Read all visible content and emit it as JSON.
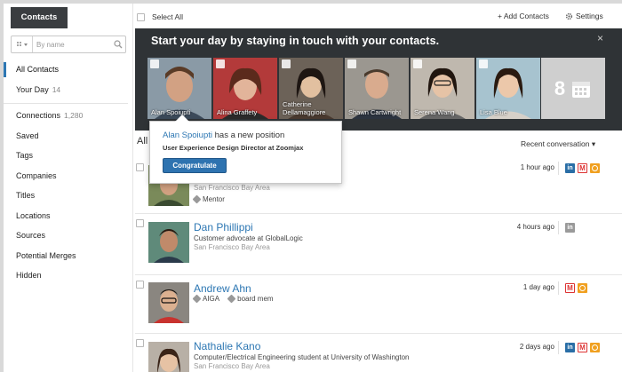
{
  "sidebar": {
    "tab_label": "Contacts",
    "search_placeholder": "By name",
    "items": [
      {
        "label": "All Contacts",
        "count": ""
      },
      {
        "label": "Your Day",
        "count": "14"
      },
      {
        "label": "Connections",
        "count": "1,280"
      },
      {
        "label": "Saved",
        "count": ""
      },
      {
        "label": "Tags",
        "count": ""
      },
      {
        "label": "Companies",
        "count": ""
      },
      {
        "label": "Titles",
        "count": ""
      },
      {
        "label": "Locations",
        "count": ""
      },
      {
        "label": "Sources",
        "count": ""
      },
      {
        "label": "Potential Merges",
        "count": ""
      },
      {
        "label": "Hidden",
        "count": ""
      }
    ]
  },
  "toolbar": {
    "select_all": "Select All",
    "add_contacts": "+ Add Contacts",
    "settings": "Settings"
  },
  "banner": {
    "title": "Start your day by staying in touch with your contacts.",
    "close": "×",
    "people": [
      {
        "name": "Alan Spoiupti"
      },
      {
        "name": "Alina Graffety"
      },
      {
        "name": "Catherine Dellamaggiore"
      },
      {
        "name": "Shawn Cartwright"
      },
      {
        "name": "Serena Wang"
      },
      {
        "name": "Lisa Blue"
      }
    ],
    "more_count": "8"
  },
  "popup": {
    "person": "Alan Spoiupti",
    "message": " has a new position",
    "position": "User Experience Design Director at Zoomjax",
    "button": "Congratulate"
  },
  "list": {
    "heading": "All",
    "sort_label": "Recent conversation ▾"
  },
  "contacts": [
    {
      "name": "",
      "line": "",
      "location": "San Francisco Bay Area",
      "tags": [
        "Mentor"
      ],
      "time": "1 hour ago",
      "sources": [
        "linkedin",
        "gmail",
        "outlook"
      ]
    },
    {
      "name": "Dan Phillippi",
      "line": "Customer advocate at GlobalLogic",
      "location": "San Francisco Bay Area",
      "tags": [],
      "time": "4 hours ago",
      "sources": [
        "linkedin-gray"
      ]
    },
    {
      "name": "Andrew Ahn",
      "line": "",
      "location": "",
      "tags": [
        "AIGA",
        "board mem"
      ],
      "time": "1 day ago",
      "sources": [
        "gmail",
        "outlook"
      ]
    },
    {
      "name": "Nathalie Kano",
      "line": "Computer/Electrical Engineering student at University of Washington",
      "location": "San Francisco Bay Area",
      "tags": [],
      "time": "2 days ago",
      "sources": [
        "linkedin",
        "gmail",
        "outlook"
      ]
    }
  ],
  "colors": {
    "accent": "#2d77b3",
    "banner_bg": "#2f3336",
    "button": "#2e73b0"
  }
}
